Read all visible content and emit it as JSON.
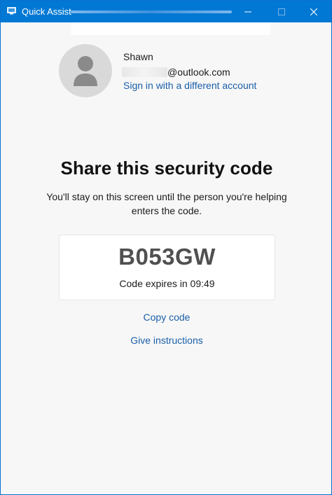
{
  "window": {
    "title": "Quick Assist",
    "accent": "#0078d4"
  },
  "titlebar_buttons": {
    "minimize_icon": "minimize-icon",
    "maximize_icon": "maximize-icon",
    "close_icon": "close-icon"
  },
  "account": {
    "name": "Shawn",
    "email_domain": "@outlook.com",
    "switch_link": "Sign in with a different account",
    "avatar_icon": "person-icon"
  },
  "share": {
    "heading": "Share this security code",
    "description": "You'll stay on this screen until the person you're helping enters the code.",
    "code": "B053GW",
    "expires": "Code expires in 09:49"
  },
  "actions": {
    "copy_code": "Copy code",
    "give_instructions": "Give instructions"
  }
}
